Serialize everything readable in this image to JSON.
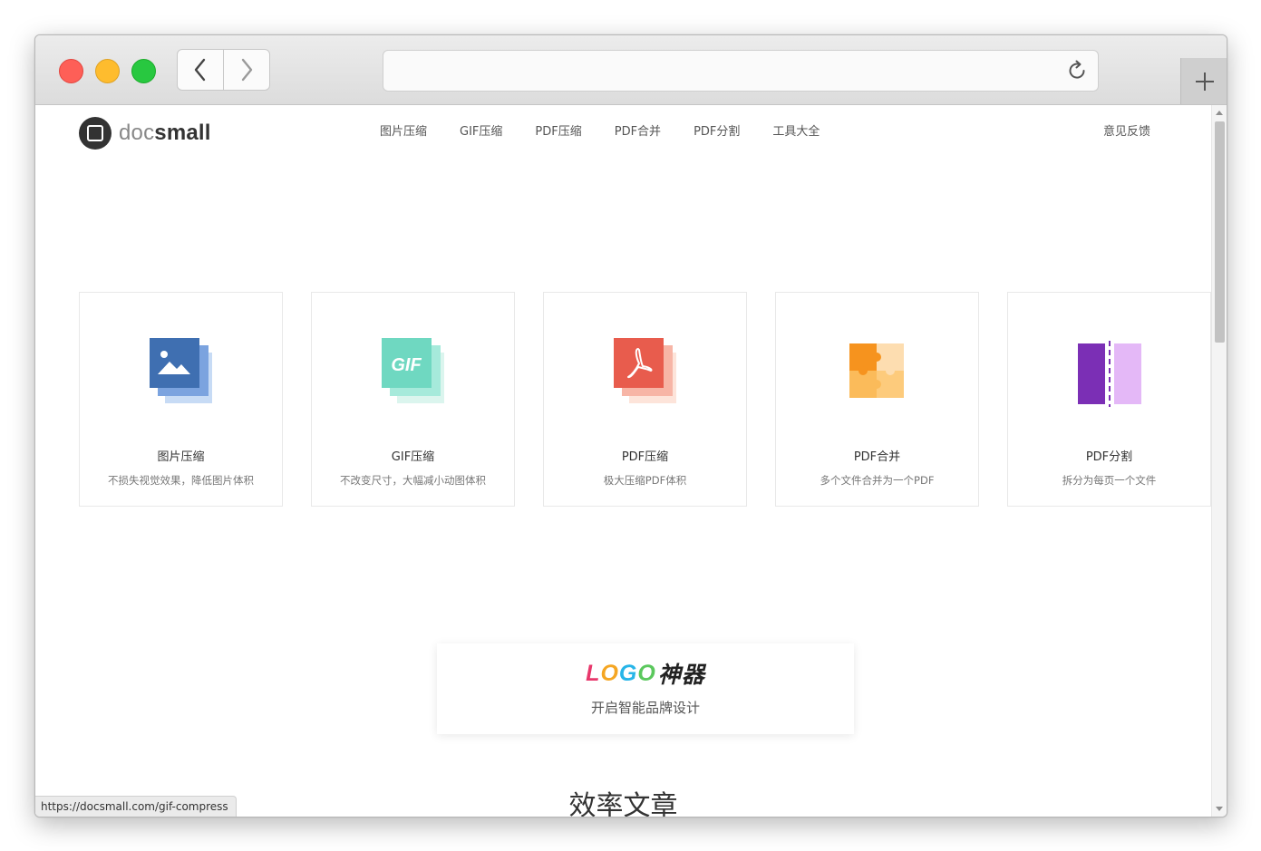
{
  "browser": {
    "address_text": "",
    "status_url": "https://docsmall.com/gif-compress"
  },
  "site": {
    "logo_prefix": "doc",
    "logo_suffix": "small",
    "nav": [
      "图片压缩",
      "GIF压缩",
      "PDF压缩",
      "PDF合并",
      "PDF分割",
      "工具大全"
    ],
    "feedback": "意见反馈"
  },
  "tools": [
    {
      "title": "图片压缩",
      "desc": "不损失视觉效果，降低图片体积",
      "icon": "image-compress-icon",
      "color": "#3f72b5"
    },
    {
      "title": "GIF压缩",
      "desc": "不改变尺寸，大幅减小动图体积",
      "icon": "gif-compress-icon",
      "color": "#6ed9c0"
    },
    {
      "title": "PDF压缩",
      "desc": "极大压缩PDF体积",
      "icon": "pdf-compress-icon",
      "color": "#e95b4e"
    },
    {
      "title": "PDF合并",
      "desc": "多个文件合并为一个PDF",
      "icon": "puzzle-merge-icon",
      "color": "#f5a033"
    },
    {
      "title": "PDF分割",
      "desc": "拆分为每页一个文件",
      "icon": "split-icon",
      "color": "#7b2fb5"
    }
  ],
  "gif_badge": "GIF",
  "promo": {
    "logo_letters": [
      "L",
      "O",
      "G",
      "O"
    ],
    "logo_suffix": "神器",
    "subtitle": "开启智能品牌设计"
  },
  "section_title": "效率文章"
}
